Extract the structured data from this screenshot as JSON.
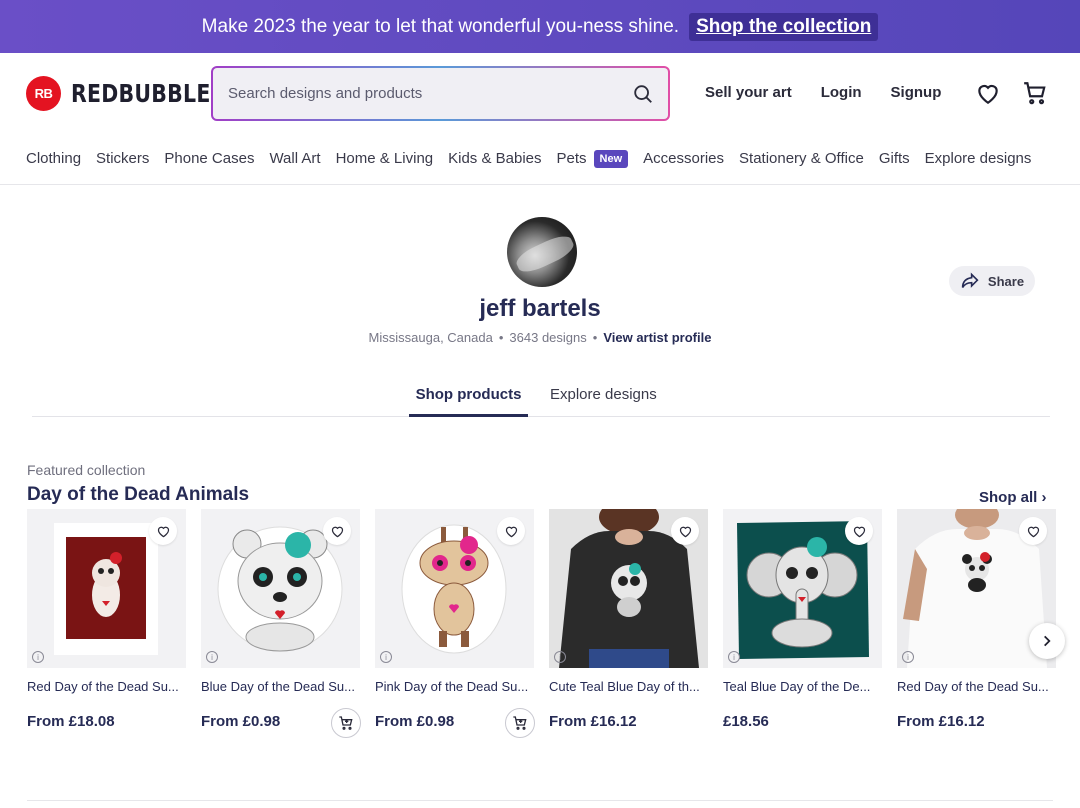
{
  "promo": {
    "message": "Make 2023 the year to let that wonderful you-ness shine.",
    "cta": "Shop the collection"
  },
  "header": {
    "logo_mark": "RB",
    "logo_text": "REDBUBBLE",
    "search_placeholder": "Search designs and products",
    "links": {
      "sell": "Sell your art",
      "login": "Login",
      "signup": "Signup"
    }
  },
  "categories": [
    "Clothing",
    "Stickers",
    "Phone Cases",
    "Wall Art",
    "Home & Living",
    "Kids & Babies",
    "Pets",
    "Accessories",
    "Stationery & Office",
    "Gifts",
    "Explore designs"
  ],
  "new_badge": "New",
  "artist": {
    "name": "jeff bartels",
    "location": "Mississauga, Canada",
    "designs": "3643 designs",
    "profile_link": "View artist profile",
    "share": "Share"
  },
  "tabs": {
    "products": "Shop products",
    "designs": "Explore designs"
  },
  "collection": {
    "eyebrow": "Featured collection",
    "title": "Day of the Dead Animals",
    "shop_all": "Shop all",
    "items": [
      {
        "title": "Red Day of the Dead Su...",
        "price": "From £18.08"
      },
      {
        "title": "Blue Day of the Dead Su...",
        "price": "From £0.98"
      },
      {
        "title": "Pink Day of the Dead Su...",
        "price": "From £0.98"
      },
      {
        "title": "Cute Teal Blue Day of th...",
        "price": "From £16.12"
      },
      {
        "title": "Teal Blue Day of the De...",
        "price": "£18.56"
      },
      {
        "title": "Red Day of the Dead Su...",
        "price": "From £16.12"
      }
    ]
  },
  "colors": {
    "promo_bg": "#5a47bd",
    "brand_red": "#e41321",
    "navy_text": "#262b55"
  }
}
